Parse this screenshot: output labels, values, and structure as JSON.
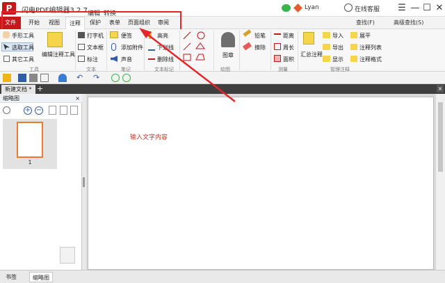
{
  "app": {
    "logo": "P",
    "title": "闪电PDF编辑器3.2.7",
    "user": "Lyan",
    "service": "在线客服"
  },
  "menubar": {
    "edit": "编辑",
    "convert": "转换"
  },
  "window_controls": {
    "menu": "☰",
    "minimize": "—",
    "maximize": "☐",
    "close": "✕"
  },
  "tabs": [
    "文件",
    "开始",
    "视图",
    "注释",
    "保护",
    "表单",
    "页面组织",
    "审阅"
  ],
  "right_links": {
    "find": "查找(F)",
    "advanced_find": "高级查找(S)"
  },
  "ribbon": {
    "tools": {
      "hand": "手形工具",
      "select": "选取工具",
      "other": "其它工具",
      "group": "工具"
    },
    "edit_annot": "编辑注释工具",
    "text": {
      "typewriter": "打字机",
      "textbox": "文本框",
      "callout": "标注",
      "group": "文本"
    },
    "note": {
      "sticky": "便签",
      "attach": "添加附件",
      "sound": "声音",
      "group": "笔记"
    },
    "markup": {
      "highlight": "高亮",
      "underline": "下划线",
      "strike": "删除线",
      "group": "文本标记"
    },
    "stamp": {
      "label": "图章",
      "group": "绘图"
    },
    "draw": {
      "pencil": "铅笔",
      "eraser": "擦除"
    },
    "measure": {
      "distance": "距离",
      "perimeter": "周长",
      "area": "面积",
      "group": "测量"
    },
    "manage": {
      "summary": "汇总注释",
      "import": "导入",
      "export": "导出",
      "show": "显示",
      "expand": "展平",
      "list": "注释列表",
      "format": "注释格式",
      "group": "管理注释"
    }
  },
  "doc_tab": {
    "name": "新建文档 *",
    "add": "+",
    "close": "×"
  },
  "thumbnail_panel": {
    "title": "缩略图",
    "close": "×",
    "page_number": "1"
  },
  "document": {
    "text": "输入文字内容"
  },
  "bottom_tabs": [
    "书签",
    "缩略图"
  ],
  "colors": {
    "brand": "#c8161d",
    "highlight": "#e3262a",
    "thumb_border": "#f07a2a"
  }
}
